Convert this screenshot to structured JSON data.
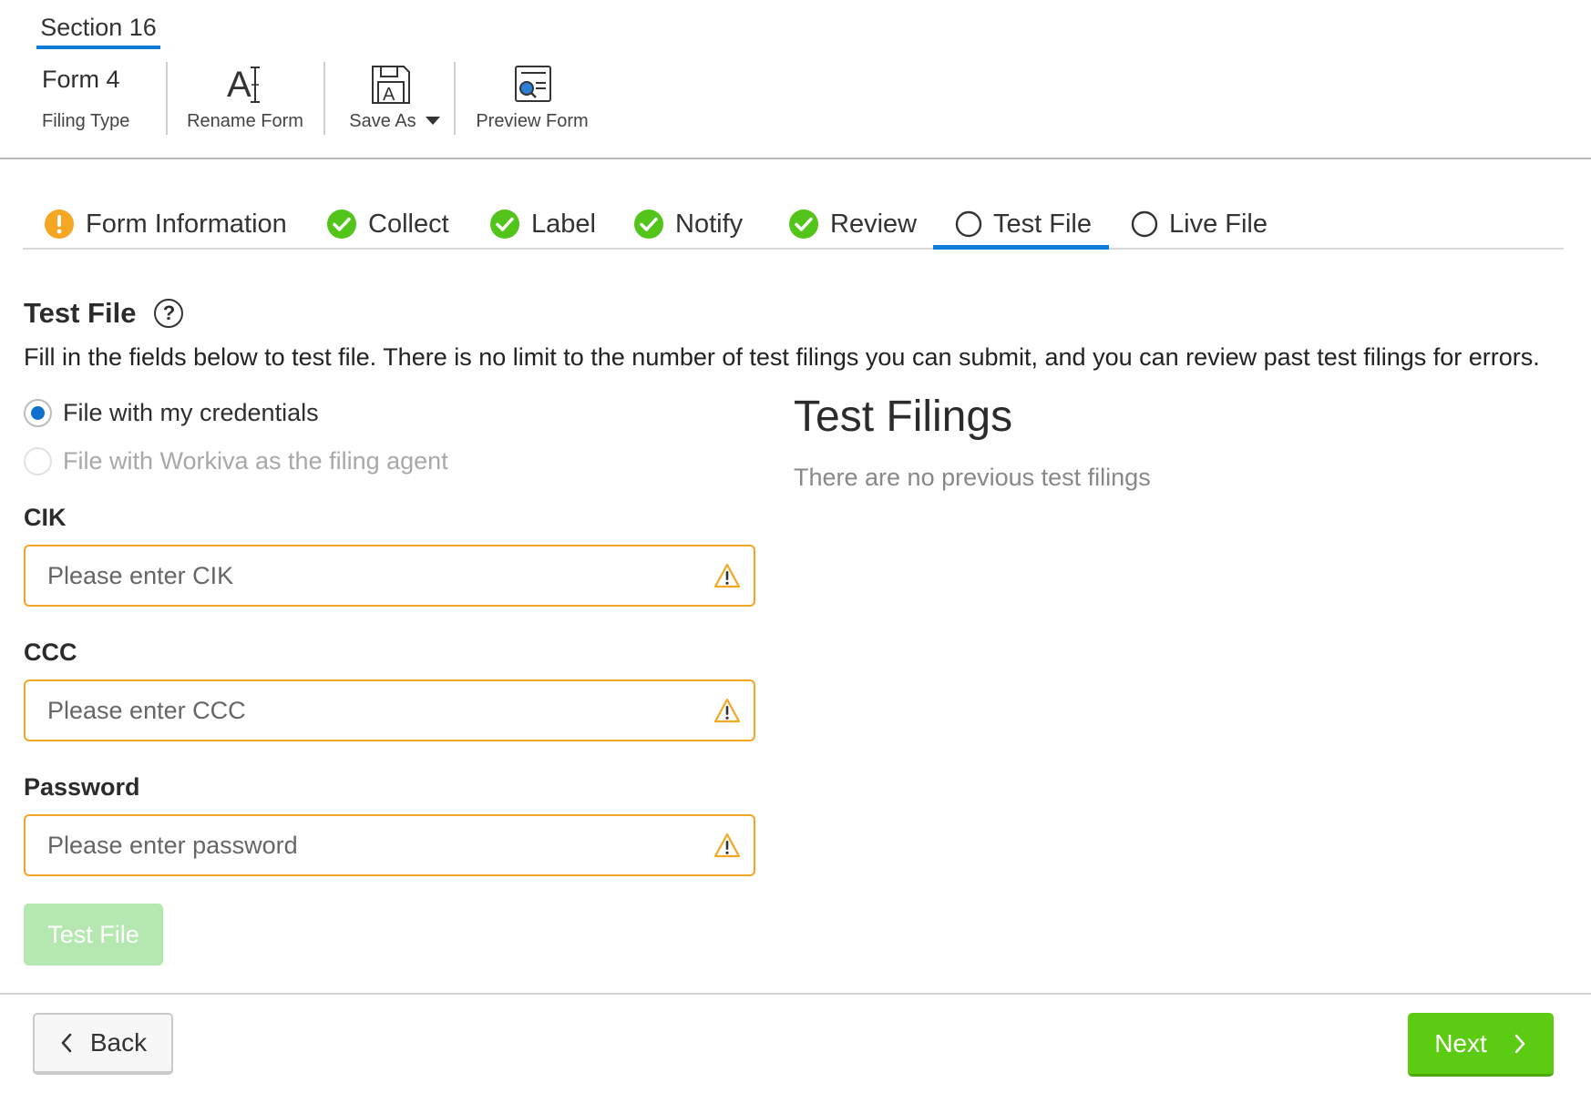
{
  "header": {
    "section_tab": "Section 16"
  },
  "toolbar": {
    "filing_type": {
      "value": "Form 4",
      "caption": "Filing Type"
    },
    "rename": {
      "caption": "Rename Form",
      "icon": "rename-icon"
    },
    "save_as": {
      "caption": "Save As",
      "icon": "save-as-icon"
    },
    "preview": {
      "caption": "Preview Form",
      "icon": "preview-form-icon"
    }
  },
  "steps": [
    {
      "label": "Form Information",
      "status": "warning"
    },
    {
      "label": "Collect",
      "status": "complete"
    },
    {
      "label": "Label",
      "status": "complete"
    },
    {
      "label": "Notify",
      "status": "complete"
    },
    {
      "label": "Review",
      "status": "complete"
    },
    {
      "label": "Test File",
      "status": "active"
    },
    {
      "label": "Live File",
      "status": "pending"
    }
  ],
  "content": {
    "title": "Test File",
    "help": "?",
    "description": "Fill in the fields below to test file. There is no limit to the number of test filings you can submit, and you can review past test filings for errors.",
    "options": [
      {
        "label": "File with my credentials",
        "selected": true,
        "disabled": false
      },
      {
        "label": "File with Workiva as the filing agent",
        "selected": false,
        "disabled": true
      }
    ],
    "fields": {
      "cik": {
        "label": "CIK",
        "placeholder": "Please enter CIK",
        "value": ""
      },
      "ccc": {
        "label": "CCC",
        "placeholder": "Please enter CCC",
        "value": ""
      },
      "password": {
        "label": "Password",
        "placeholder": "Please enter password",
        "value": ""
      }
    },
    "test_button": "Test File",
    "test_filings": {
      "title": "Test Filings",
      "empty": "There are no previous test filings"
    }
  },
  "footer": {
    "back": "Back",
    "next": "Next"
  },
  "colors": {
    "accent": "#0f7bd8",
    "success": "#52c41a",
    "warning": "#f5a623",
    "next_button": "#5ccc12",
    "test_button_disabled": "#b5e8b0"
  }
}
